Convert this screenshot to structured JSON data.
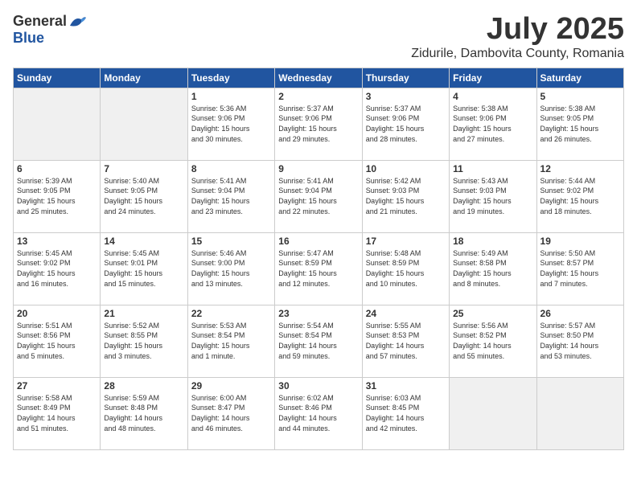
{
  "logo": {
    "general": "General",
    "blue": "Blue"
  },
  "title": {
    "month": "July 2025",
    "location": "Zidurile, Dambovita County, Romania"
  },
  "headers": [
    "Sunday",
    "Monday",
    "Tuesday",
    "Wednesday",
    "Thursday",
    "Friday",
    "Saturday"
  ],
  "weeks": [
    [
      {
        "day": "",
        "info": ""
      },
      {
        "day": "",
        "info": ""
      },
      {
        "day": "1",
        "info": "Sunrise: 5:36 AM\nSunset: 9:06 PM\nDaylight: 15 hours\nand 30 minutes."
      },
      {
        "day": "2",
        "info": "Sunrise: 5:37 AM\nSunset: 9:06 PM\nDaylight: 15 hours\nand 29 minutes."
      },
      {
        "day": "3",
        "info": "Sunrise: 5:37 AM\nSunset: 9:06 PM\nDaylight: 15 hours\nand 28 minutes."
      },
      {
        "day": "4",
        "info": "Sunrise: 5:38 AM\nSunset: 9:06 PM\nDaylight: 15 hours\nand 27 minutes."
      },
      {
        "day": "5",
        "info": "Sunrise: 5:38 AM\nSunset: 9:05 PM\nDaylight: 15 hours\nand 26 minutes."
      }
    ],
    [
      {
        "day": "6",
        "info": "Sunrise: 5:39 AM\nSunset: 9:05 PM\nDaylight: 15 hours\nand 25 minutes."
      },
      {
        "day": "7",
        "info": "Sunrise: 5:40 AM\nSunset: 9:05 PM\nDaylight: 15 hours\nand 24 minutes."
      },
      {
        "day": "8",
        "info": "Sunrise: 5:41 AM\nSunset: 9:04 PM\nDaylight: 15 hours\nand 23 minutes."
      },
      {
        "day": "9",
        "info": "Sunrise: 5:41 AM\nSunset: 9:04 PM\nDaylight: 15 hours\nand 22 minutes."
      },
      {
        "day": "10",
        "info": "Sunrise: 5:42 AM\nSunset: 9:03 PM\nDaylight: 15 hours\nand 21 minutes."
      },
      {
        "day": "11",
        "info": "Sunrise: 5:43 AM\nSunset: 9:03 PM\nDaylight: 15 hours\nand 19 minutes."
      },
      {
        "day": "12",
        "info": "Sunrise: 5:44 AM\nSunset: 9:02 PM\nDaylight: 15 hours\nand 18 minutes."
      }
    ],
    [
      {
        "day": "13",
        "info": "Sunrise: 5:45 AM\nSunset: 9:02 PM\nDaylight: 15 hours\nand 16 minutes."
      },
      {
        "day": "14",
        "info": "Sunrise: 5:45 AM\nSunset: 9:01 PM\nDaylight: 15 hours\nand 15 minutes."
      },
      {
        "day": "15",
        "info": "Sunrise: 5:46 AM\nSunset: 9:00 PM\nDaylight: 15 hours\nand 13 minutes."
      },
      {
        "day": "16",
        "info": "Sunrise: 5:47 AM\nSunset: 8:59 PM\nDaylight: 15 hours\nand 12 minutes."
      },
      {
        "day": "17",
        "info": "Sunrise: 5:48 AM\nSunset: 8:59 PM\nDaylight: 15 hours\nand 10 minutes."
      },
      {
        "day": "18",
        "info": "Sunrise: 5:49 AM\nSunset: 8:58 PM\nDaylight: 15 hours\nand 8 minutes."
      },
      {
        "day": "19",
        "info": "Sunrise: 5:50 AM\nSunset: 8:57 PM\nDaylight: 15 hours\nand 7 minutes."
      }
    ],
    [
      {
        "day": "20",
        "info": "Sunrise: 5:51 AM\nSunset: 8:56 PM\nDaylight: 15 hours\nand 5 minutes."
      },
      {
        "day": "21",
        "info": "Sunrise: 5:52 AM\nSunset: 8:55 PM\nDaylight: 15 hours\nand 3 minutes."
      },
      {
        "day": "22",
        "info": "Sunrise: 5:53 AM\nSunset: 8:54 PM\nDaylight: 15 hours\nand 1 minute."
      },
      {
        "day": "23",
        "info": "Sunrise: 5:54 AM\nSunset: 8:54 PM\nDaylight: 14 hours\nand 59 minutes."
      },
      {
        "day": "24",
        "info": "Sunrise: 5:55 AM\nSunset: 8:53 PM\nDaylight: 14 hours\nand 57 minutes."
      },
      {
        "day": "25",
        "info": "Sunrise: 5:56 AM\nSunset: 8:52 PM\nDaylight: 14 hours\nand 55 minutes."
      },
      {
        "day": "26",
        "info": "Sunrise: 5:57 AM\nSunset: 8:50 PM\nDaylight: 14 hours\nand 53 minutes."
      }
    ],
    [
      {
        "day": "27",
        "info": "Sunrise: 5:58 AM\nSunset: 8:49 PM\nDaylight: 14 hours\nand 51 minutes."
      },
      {
        "day": "28",
        "info": "Sunrise: 5:59 AM\nSunset: 8:48 PM\nDaylight: 14 hours\nand 48 minutes."
      },
      {
        "day": "29",
        "info": "Sunrise: 6:00 AM\nSunset: 8:47 PM\nDaylight: 14 hours\nand 46 minutes."
      },
      {
        "day": "30",
        "info": "Sunrise: 6:02 AM\nSunset: 8:46 PM\nDaylight: 14 hours\nand 44 minutes."
      },
      {
        "day": "31",
        "info": "Sunrise: 6:03 AM\nSunset: 8:45 PM\nDaylight: 14 hours\nand 42 minutes."
      },
      {
        "day": "",
        "info": ""
      },
      {
        "day": "",
        "info": ""
      }
    ]
  ]
}
